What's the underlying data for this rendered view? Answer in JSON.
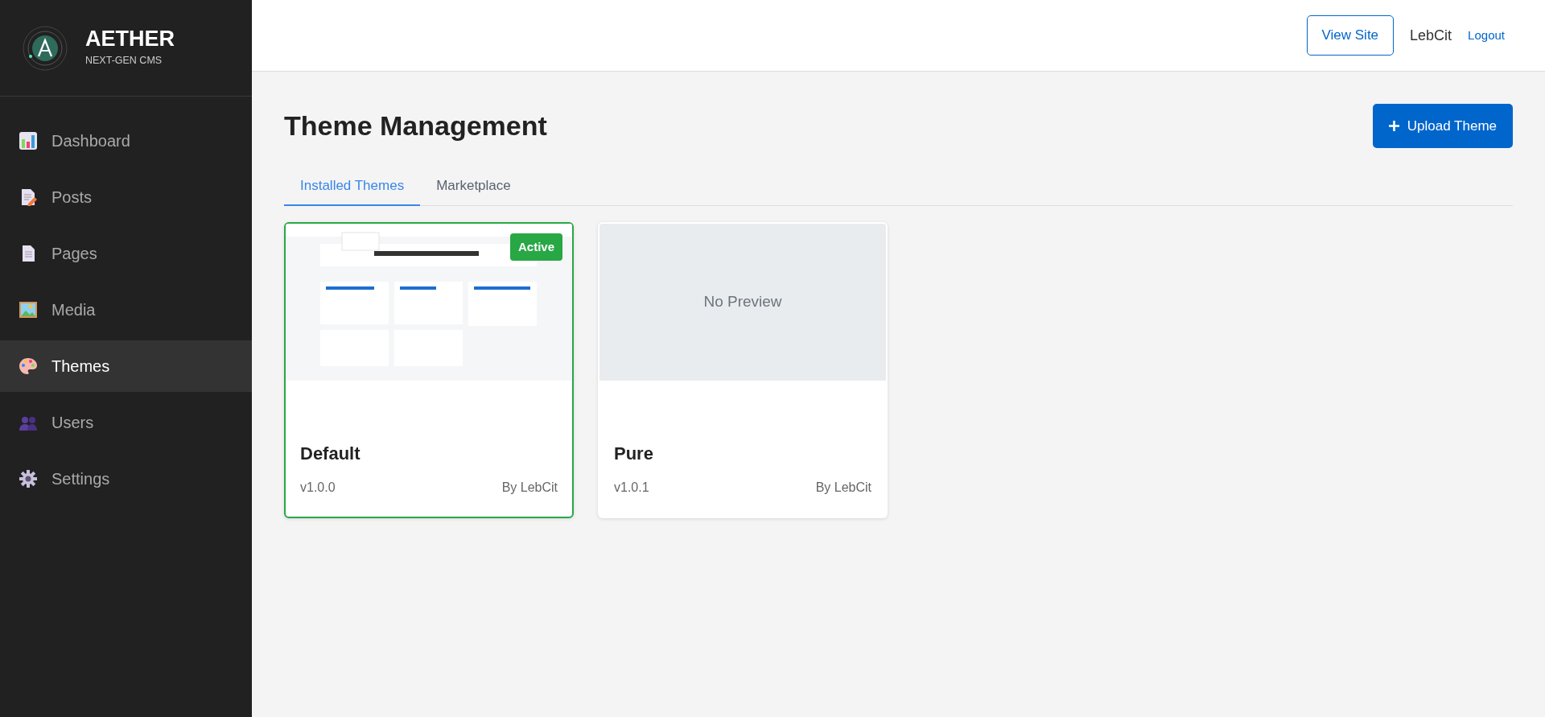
{
  "brand": {
    "name": "AETHER",
    "tagline": "NEXT-GEN CMS"
  },
  "sidebar": {
    "items": [
      {
        "label": "Dashboard",
        "selected": false
      },
      {
        "label": "Posts",
        "selected": false
      },
      {
        "label": "Pages",
        "selected": false
      },
      {
        "label": "Media",
        "selected": false
      },
      {
        "label": "Themes",
        "selected": true
      },
      {
        "label": "Users",
        "selected": false
      },
      {
        "label": "Settings",
        "selected": false
      }
    ]
  },
  "header": {
    "view_site": "View Site",
    "user": "LebCit",
    "logout": "Logout"
  },
  "page": {
    "title": "Theme Management",
    "upload_button": "Upload Theme"
  },
  "tabs": [
    {
      "label": "Installed Themes",
      "selected": true
    },
    {
      "label": "Marketplace",
      "selected": false
    }
  ],
  "themes": [
    {
      "name": "Default",
      "version": "v1.0.0",
      "author": "By LebCit",
      "active": true,
      "badge": "Active"
    },
    {
      "name": "Pure",
      "version": "v1.0.1",
      "author": "By LebCit",
      "active": false,
      "no_preview": "No Preview"
    }
  ]
}
